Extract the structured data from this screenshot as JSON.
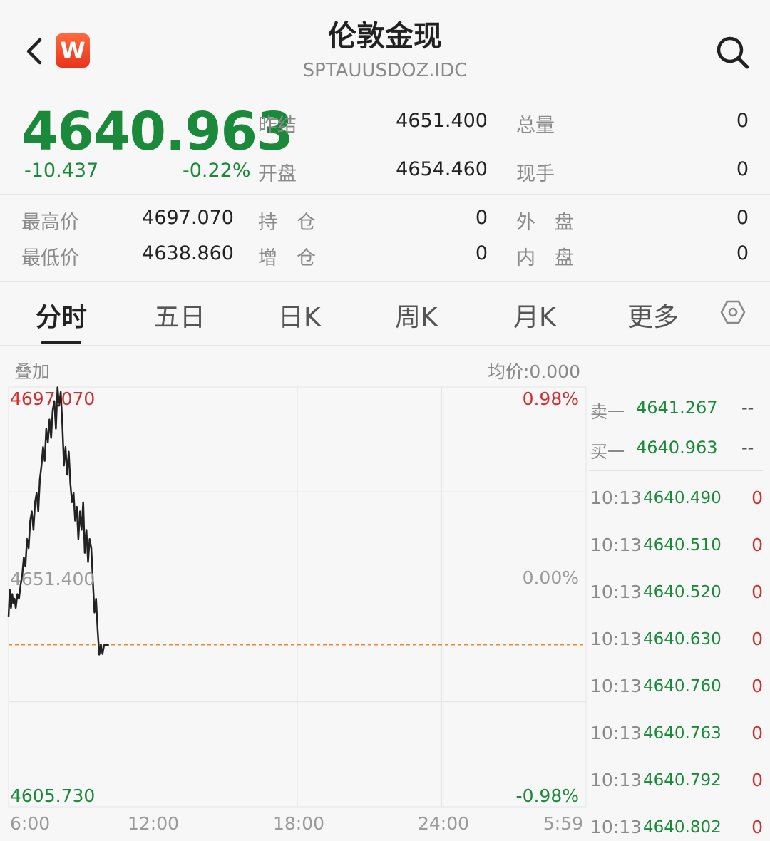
{
  "header": {
    "title": "伦敦金现",
    "code": "SPTAUUSDOZ.IDC",
    "logo_letter": "W"
  },
  "quote": {
    "last": "4640.963",
    "change": "-10.437",
    "change_pct": "-0.22%",
    "fields": [
      {
        "label": "昨结",
        "value": "4651.400"
      },
      {
        "label": "开盘",
        "value": "4654.460"
      },
      {
        "label": "总量",
        "value": "0"
      },
      {
        "label": "现手",
        "value": "0"
      },
      {
        "label": "最高价",
        "value": "4697.070"
      },
      {
        "label": "最低价",
        "value": "4638.860"
      },
      {
        "label": "持　仓",
        "value": "0"
      },
      {
        "label": "增　仓",
        "value": "0"
      },
      {
        "label": "外　盘",
        "value": "0"
      },
      {
        "label": "内　盘",
        "value": "0"
      }
    ]
  },
  "tabs": [
    "分时",
    "五日",
    "日K",
    "周K",
    "月K",
    "更多"
  ],
  "chart": {
    "overlay_label": "叠加",
    "avg_price_label": "均价:0.000",
    "y_high": "4697.070",
    "y_mid": "4651.400",
    "y_low": "4605.730",
    "pct_high": "0.98%",
    "pct_mid": "0.00%",
    "pct_low": "-0.98%",
    "x_labels": [
      "6:00",
      "12:00",
      "18:00",
      "24:00",
      "5:59"
    ]
  },
  "chart_data": {
    "type": "line",
    "title": "",
    "xlabel": "",
    "ylabel": "",
    "ylim": [
      4605.73,
      4697.07
    ],
    "x_range_minutes": [
      0,
      1439
    ],
    "reference_value": 4651.4,
    "dashed_line_value": 4640.963,
    "grid": true,
    "series": [
      {
        "x": [
          0,
          3,
          6,
          9,
          12,
          15,
          18,
          22,
          26,
          30,
          34,
          38,
          42,
          46,
          50,
          54,
          58,
          62,
          66,
          70,
          74,
          78,
          82,
          86,
          90,
          94,
          98,
          102,
          106,
          110,
          114,
          118,
          122,
          126,
          130,
          134,
          138,
          142,
          146,
          150,
          154,
          158,
          162,
          166,
          170,
          174,
          178,
          182,
          186,
          190,
          194,
          198,
          202,
          206,
          210,
          214,
          218,
          222,
          226,
          230,
          234,
          238,
          242,
          246,
          250
        ],
        "y": [
          4647,
          4653,
          4649,
          4652,
          4650,
          4651,
          4649,
          4652,
          4651,
          4654,
          4656,
          4660,
          4658,
          4664,
          4662,
          4668,
          4670,
          4666,
          4672,
          4674,
          4670,
          4677,
          4680,
          4684,
          4681,
          4688,
          4685,
          4690,
          4686,
          4692,
          4694,
          4688,
          4697,
          4693,
          4696,
          4689,
          4680,
          4684,
          4678,
          4683,
          4676,
          4672,
          4674,
          4668,
          4671,
          4664,
          4670,
          4666,
          4672,
          4661,
          4666,
          4659,
          4664,
          4662,
          4655,
          4648,
          4651,
          4644,
          4638.86,
          4641,
          4639,
          4640.9,
          4640.963,
          4640.963,
          4640.963
        ]
      }
    ]
  },
  "order_book": [
    {
      "label": "卖一",
      "price": "4641.267",
      "vol": "--"
    },
    {
      "label": "买一",
      "price": "4640.963",
      "vol": "--"
    }
  ],
  "ticks": [
    {
      "time": "10:13",
      "price": "4640.490",
      "vol": "0"
    },
    {
      "time": "10:13",
      "price": "4640.510",
      "vol": "0"
    },
    {
      "time": "10:13",
      "price": "4640.520",
      "vol": "0"
    },
    {
      "time": "10:13",
      "price": "4640.630",
      "vol": "0"
    },
    {
      "time": "10:13",
      "price": "4640.760",
      "vol": "0"
    },
    {
      "time": "10:13",
      "price": "4640.763",
      "vol": "0"
    },
    {
      "time": "10:13",
      "price": "4640.792",
      "vol": "0"
    },
    {
      "time": "10:13",
      "price": "4640.802",
      "vol": "0"
    }
  ]
}
